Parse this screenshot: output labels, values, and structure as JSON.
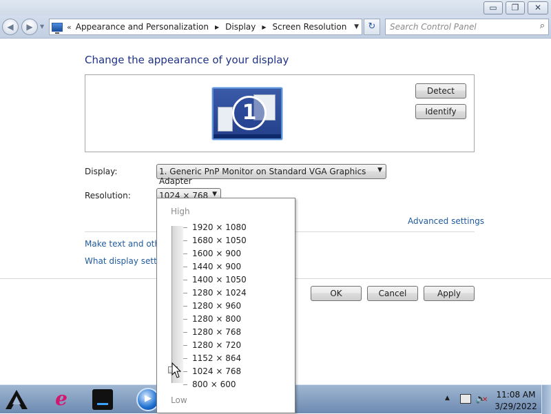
{
  "window_buttons": {
    "minimize": "▭",
    "maximize": "❐",
    "close": "✕"
  },
  "nav": {
    "back_glyph": "◀",
    "forward_glyph": "▶",
    "breadcrumb_overflow": "«",
    "breadcrumbs": [
      "Appearance and Personalization",
      "Display",
      "Screen Resolution"
    ],
    "refresh_glyph": "↻"
  },
  "search": {
    "placeholder": "Search Control Panel"
  },
  "main": {
    "title": "Change the appearance of your display",
    "monitor_number": "1",
    "detect_label": "Detect",
    "identify_label": "Identify",
    "display_label": "Display:",
    "display_value": "1. Generic PnP Monitor on Standard VGA Graphics Adapter",
    "resolution_label": "Resolution:",
    "resolution_value": "1024 × 768",
    "advanced_settings": "Advanced settings",
    "link_text_size": "Make text and other",
    "link_settings": "What display setting",
    "ok_label": "OK",
    "cancel_label": "Cancel",
    "apply_label": "Apply"
  },
  "resolution_popup": {
    "high_label": "High",
    "low_label": "Low",
    "options": [
      "1920 × 1080",
      "1680 × 1050",
      "1600 × 900",
      "1440 × 900",
      "1400 × 1050",
      "1280 × 1024",
      "1280 × 960",
      "1280 × 800",
      "1280 × 768",
      "1280 × 720",
      "1152 × 864",
      "1024 × 768",
      "800 × 600"
    ],
    "selected": "1024 × 768"
  },
  "taskbar": {
    "clock_time": "11:08 AM",
    "clock_date": "3/29/2022",
    "tray_overflow": "▲"
  },
  "colors": {
    "title_blue": "#1e3287",
    "link_blue": "#1f5a9e",
    "taskbar": "#7d98bd"
  },
  "icons": [
    "search-icon",
    "refresh-icon",
    "control-panel-icon",
    "ie-icon",
    "explorer-icon",
    "media-player-icon",
    "network-icon",
    "volume-muted-icon"
  ]
}
